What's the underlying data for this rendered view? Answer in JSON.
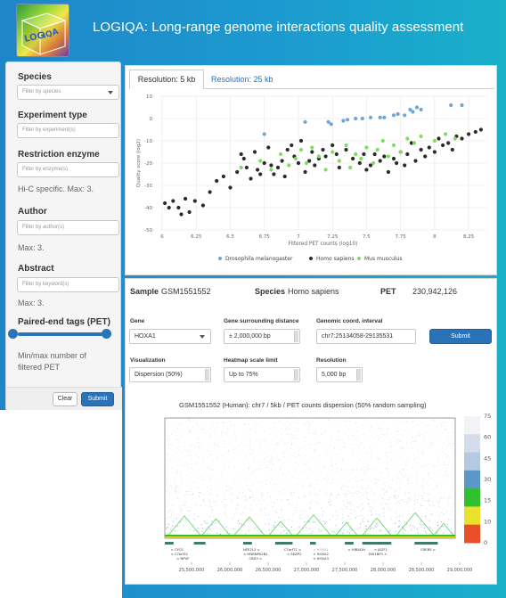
{
  "header": {
    "logo_text": "LOGIQA",
    "title": "LOGIQA: Long-range genome interactions quality assessment"
  },
  "filters": {
    "species": {
      "label": "Species",
      "placeholder": "Filter by species"
    },
    "experiment_type": {
      "label": "Experiment type",
      "placeholder": "Filter by experiment(s)"
    },
    "restriction_enzyme": {
      "label": "Restriction enzyme",
      "placeholder": "Filter by enzyme(s)",
      "help": "Hi-C specific. Max: 3."
    },
    "author": {
      "label": "Author",
      "placeholder": "Filter by author(s)",
      "help": "Max: 3."
    },
    "abstract": {
      "label": "Abstract",
      "placeholder": "Filter by keyword(s)",
      "help": "Max: 3."
    },
    "pet": {
      "label": "Paired-end tags (PET)",
      "help_line1": "Min/max number of",
      "help_line2": "filtered PET",
      "min_fraction": 0.0,
      "max_fraction": 1.0
    },
    "clear_label": "Clear",
    "submit_label": "Submit"
  },
  "tabs": [
    {
      "label": "Resolution: 5 kb",
      "active": true
    },
    {
      "label": "Resolution: 25 kb",
      "active": false
    }
  ],
  "chart_data": {
    "type": "scatter",
    "xlabel": "Filtered PET counts (log10)",
    "ylabel": "Quality score (log2)",
    "xlim": [
      5.98,
      8.38
    ],
    "ylim": [
      -50,
      10
    ],
    "xticks": [
      6,
      6.25,
      6.5,
      6.75,
      7,
      7.25,
      7.5,
      7.75,
      8,
      8.25
    ],
    "xtick_labels": [
      "6",
      "6.25",
      "6.5",
      "6.75",
      "7",
      "7.25",
      "7.5",
      "7.75",
      "8",
      "8.25"
    ],
    "yticks": [
      10,
      0,
      -10,
      -20,
      -30,
      -40,
      -50
    ],
    "grid": true,
    "legend_position": "bottom",
    "series": [
      {
        "name": "Drosophila melanogaster",
        "color": "#6fa6d6",
        "x": [
          6.75,
          7.05,
          7.22,
          7.24,
          7.33,
          7.36,
          7.42,
          7.47,
          7.53,
          7.6,
          7.63,
          7.7,
          7.73,
          7.78,
          7.82,
          7.84,
          7.87,
          7.9,
          8.12,
          8.2
        ],
        "y": [
          -7,
          -1.5,
          -1.5,
          -2.5,
          -1,
          -0.5,
          0,
          0,
          0.5,
          0.5,
          0.5,
          1.5,
          2,
          1.5,
          4,
          3,
          5,
          4,
          6,
          6
        ]
      },
      {
        "name": "Homo sapiens",
        "color": "#2b2b2b",
        "x": [
          6.02,
          6.05,
          6.08,
          6.12,
          6.14,
          6.17,
          6.2,
          6.24,
          6.3,
          6.35,
          6.4,
          6.45,
          6.5,
          6.55,
          6.58,
          6.6,
          6.62,
          6.65,
          6.68,
          6.7,
          6.72,
          6.75,
          6.78,
          6.8,
          6.82,
          6.85,
          6.88,
          6.9,
          6.92,
          6.95,
          6.97,
          7.0,
          7.02,
          7.05,
          7.08,
          7.1,
          7.12,
          7.15,
          7.18,
          7.2,
          7.25,
          7.28,
          7.3,
          7.35,
          7.4,
          7.45,
          7.48,
          7.5,
          7.53,
          7.56,
          7.6,
          7.63,
          7.66,
          7.7,
          7.72,
          7.75,
          7.78,
          7.8,
          7.83,
          7.86,
          7.9,
          7.93,
          7.96,
          8.0,
          8.03,
          8.06,
          8.1,
          8.13,
          8.16,
          8.2,
          8.25,
          8.3,
          8.34
        ],
        "y": [
          -38,
          -40,
          -37,
          -40,
          -43,
          -36,
          -42,
          -37,
          -39,
          -33,
          -28,
          -26,
          -31,
          -24,
          -16,
          -18,
          -22,
          -27,
          -15,
          -23,
          -25,
          -20,
          -13,
          -21,
          -25,
          -22,
          -19,
          -26,
          -14,
          -12,
          -17,
          -20,
          -10,
          -24,
          -19,
          -15,
          -21,
          -18,
          -14,
          -17,
          -12,
          -16,
          -22,
          -14,
          -18,
          -20,
          -16,
          -23,
          -21,
          -16,
          -19,
          -17,
          -24,
          -18,
          -20,
          -15,
          -21,
          -16,
          -11,
          -19,
          -14,
          -17,
          -13,
          -15,
          -9,
          -12,
          -11,
          -14,
          -8,
          -9,
          -7,
          -6,
          -5
        ]
      },
      {
        "name": "Mus musculus",
        "color": "#7fdc63",
        "x": [
          6.58,
          6.72,
          6.8,
          6.87,
          6.93,
          6.98,
          7.02,
          7.06,
          7.1,
          7.15,
          7.2,
          7.25,
          7.3,
          7.35,
          7.38,
          7.42,
          7.46,
          7.5,
          7.55,
          7.58,
          7.62,
          7.66,
          7.7,
          7.75,
          7.8,
          7.85,
          7.9,
          8.0,
          8.08,
          8.15
        ],
        "y": [
          -22,
          -19,
          -23,
          -16,
          -21,
          -18,
          -14,
          -20,
          -13,
          -17,
          -23,
          -15,
          -19,
          -12,
          -22,
          -16,
          -18,
          -13,
          -20,
          -14,
          -10,
          -17,
          -12,
          -15,
          -9,
          -11,
          -8,
          -10,
          -7,
          -9
        ]
      }
    ]
  },
  "sample": {
    "sample_label": "Sample",
    "sample_value": "GSM1551552",
    "species_label": "Species",
    "species_value": "Homo sapiens",
    "pet_label": "PET",
    "pet_value": "230,942,126"
  },
  "controls": {
    "gene": {
      "label": "Gene",
      "value": "HOXA1"
    },
    "distance": {
      "label": "Gene surrounding distance",
      "value": "± 2,000,000 bp"
    },
    "interval": {
      "label": "Genomic coord. interval",
      "value": "chr7:25134058-29135531"
    },
    "submit_label": "Submit",
    "visualization": {
      "label": "Visualization",
      "value": "Dispersion (50%)"
    },
    "heatmap_limit": {
      "label": "Heatmap scale limit",
      "value": "Up to 75%"
    },
    "resolution": {
      "label": "Resolution",
      "value": "5,000 bp"
    }
  },
  "heatmap": {
    "title": "GSM1551552 (Human): chr7 / 5kb / PET counts dispersion (50% random sampling)",
    "scale_ticks": [
      "75",
      "60",
      "45",
      "30",
      "15",
      "10",
      "0"
    ],
    "scale_colors": [
      "#f2f2f7",
      "#d4dcea",
      "#b5c9e0",
      "#5b98c7",
      "#2fbf2f",
      "#e9e12a",
      "#e9502a"
    ],
    "genome_ticks": [
      "25,500,000",
      "26,000,000",
      "26,500,000",
      "27,000,000",
      "27,500,000",
      "28,000,000",
      "28,500,000",
      "29,000,000"
    ],
    "gene_labels": [
      {
        "text": "< CYCS",
        "row": 0,
        "pos": 0.02
      },
      {
        "text": "< C7orf31",
        "row": 1,
        "pos": 0.02
      },
      {
        "text": "< NPVF",
        "row": 2,
        "pos": 0.04
      },
      {
        "text": "NFE2L3 >",
        "row": 0,
        "pos": 0.27
      },
      {
        "text": "< HNRNPA2B1",
        "row": 1,
        "pos": 0.27
      },
      {
        "text": "CBX3 >",
        "row": 2,
        "pos": 0.29
      },
      {
        "text": "C7orf71 >",
        "row": 0,
        "pos": 0.41
      },
      {
        "text": "< SKAP2",
        "row": 1,
        "pos": 0.42
      },
      {
        "text": "< HOXA1",
        "row": 0,
        "pos": 0.51
      },
      {
        "text": "< HOXA2",
        "row": 1,
        "pos": 0.51
      },
      {
        "text": "< HOXA3",
        "row": 2,
        "pos": 0.51
      },
      {
        "text": "< HIBADH",
        "row": 0,
        "pos": 0.63
      },
      {
        "text": "< JAZF1",
        "row": 0,
        "pos": 0.72
      },
      {
        "text": "TAX1BP1 >",
        "row": 1,
        "pos": 0.7
      },
      {
        "text": "CREB5 >",
        "row": 0,
        "pos": 0.88
      }
    ]
  },
  "colors": {
    "accent": "#2a73b9",
    "page_gradient_start": "#1f86c8",
    "page_gradient_end": "#19b0c9"
  }
}
